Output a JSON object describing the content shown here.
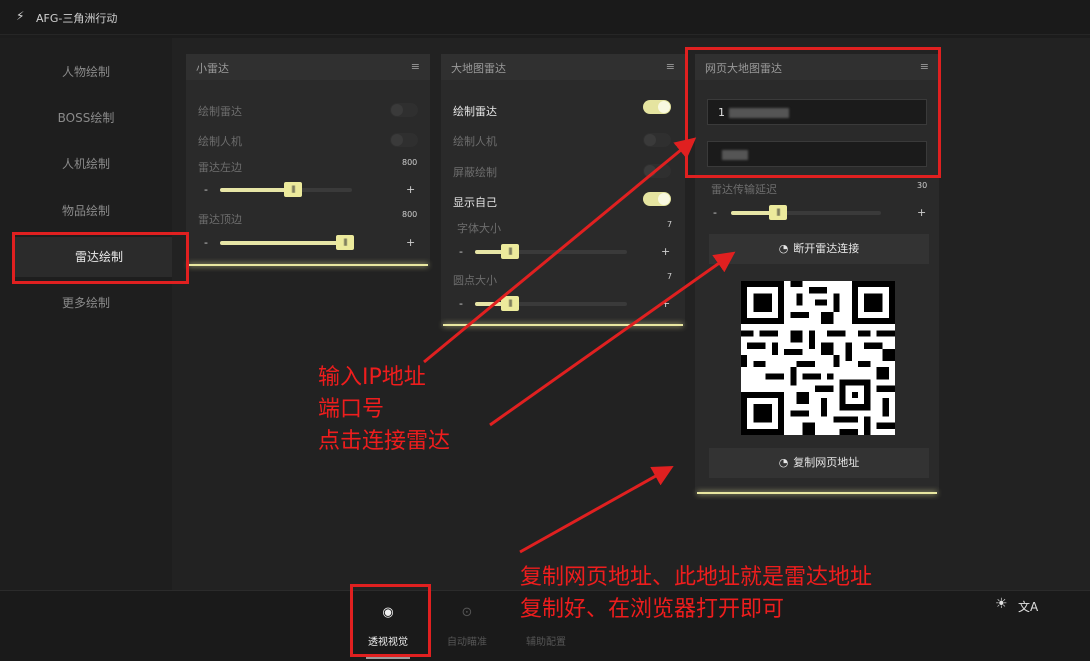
{
  "window": {
    "title": "AFG-三角洲行动"
  },
  "sidebar": {
    "items": [
      {
        "label": "人物绘制"
      },
      {
        "label": "BOSS绘制"
      },
      {
        "label": "人机绘制"
      },
      {
        "label": "物品绘制"
      },
      {
        "label": "雷达绘制",
        "active": true
      },
      {
        "label": "更多绘制"
      }
    ]
  },
  "panel_small": {
    "title": "小雷达",
    "draw_radar": {
      "label": "绘制雷达",
      "on": false
    },
    "draw_bot": {
      "label": "绘制人机",
      "on": false
    },
    "left_margin": {
      "label": "雷达左边",
      "value": "800"
    },
    "top_margin": {
      "label": "雷达顶边",
      "value": "800"
    }
  },
  "panel_big": {
    "title": "大地图雷达",
    "draw_radar": {
      "label": "绘制雷达",
      "on": true
    },
    "draw_bot": {
      "label": "绘制人机",
      "on": false
    },
    "screen_draw": {
      "label": "屏蔽绘制",
      "on": false
    },
    "show_self": {
      "label": "显示自己",
      "on": true
    },
    "font_size": {
      "label": "字体大小",
      "value": "7"
    },
    "dot_size": {
      "label": "圆点大小",
      "value": "7"
    }
  },
  "panel_web": {
    "title": "网页大地图雷达",
    "ip_value": "1",
    "port_value": "",
    "delay": {
      "label": "雷达传输延迟",
      "value": "30"
    },
    "disconnect_label": "断开雷达连接",
    "copy_label": "复制网页地址"
  },
  "bottom": {
    "tabs": [
      {
        "label": "透视视觉",
        "active": true
      },
      {
        "label": "自动瞄准",
        "active": false
      },
      {
        "label": "辅助配置",
        "active": false
      }
    ]
  },
  "annotations": {
    "note1": [
      "输入IP地址",
      "端口号",
      "点击连接雷达"
    ],
    "note2": [
      "复制网页地址、此地址就是雷达地址",
      "复制好、在浏览器打开即可"
    ]
  },
  "slider_labels": {
    "minus": "-",
    "plus": "+"
  },
  "colors": {
    "accent": "#e7e5a6",
    "annotation": "#e02020"
  },
  "icons": {
    "bolt": "⚡",
    "menu": "≡",
    "eye": "◉",
    "target": "⊙",
    "sun": "☀",
    "translate": "文A",
    "gauge": "◔"
  }
}
